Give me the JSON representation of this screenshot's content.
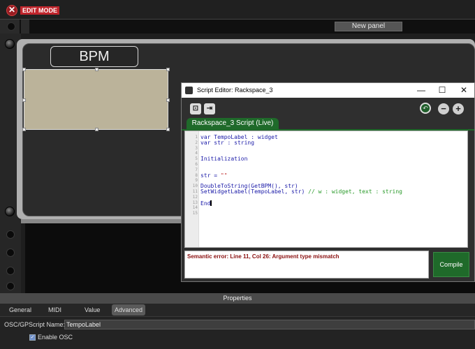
{
  "topbar": {
    "close_glyph": "✕",
    "mode_label": "EDIT MODE"
  },
  "toolbar": {
    "new_panel_label": "New panel"
  },
  "rack": {
    "widget_label_text": "BPM"
  },
  "editor": {
    "title": "Script Editor:  Rackspace_3",
    "minimize_glyph": "—",
    "maximize_glyph": "☐",
    "close_glyph": "✕",
    "tab_label": "Rackspace_3 Script (Live)",
    "line_numbers": [
      "1",
      "2",
      "3",
      "4",
      "5",
      "6",
      "7",
      "8",
      "9",
      "10",
      "11",
      "12",
      "13",
      "14",
      "15"
    ],
    "code": {
      "l1": "var TempoLabel : widget",
      "l2": "var str : string",
      "l6": "Initialization",
      "l9_a": "str = ",
      "l9_b": "\"\"",
      "l11": "DoubleToString(GetBPM(), str)",
      "l12_a": "SetWidgetLabel(TempoLabel, str) ",
      "l12_b": "// w : widget, text : string",
      "l14": "End"
    },
    "error_text": "Semantic error: Line 11, Col 26: Argument type mismatch",
    "compile_label": "Compile"
  },
  "properties": {
    "header": "Properties",
    "tabs": [
      "General",
      "MIDI",
      "Value",
      "Advanced"
    ],
    "osc_name_label": "OSC/GPScript Name:",
    "osc_name_value": "TempoLabel",
    "enable_osc_label": "Enable OSC",
    "enable_osc_checked": true
  },
  "colors": {
    "accent_green": "#1f6a2a",
    "edit_mode_red": "#c0252c",
    "widget_fill": "#bbb39a"
  }
}
